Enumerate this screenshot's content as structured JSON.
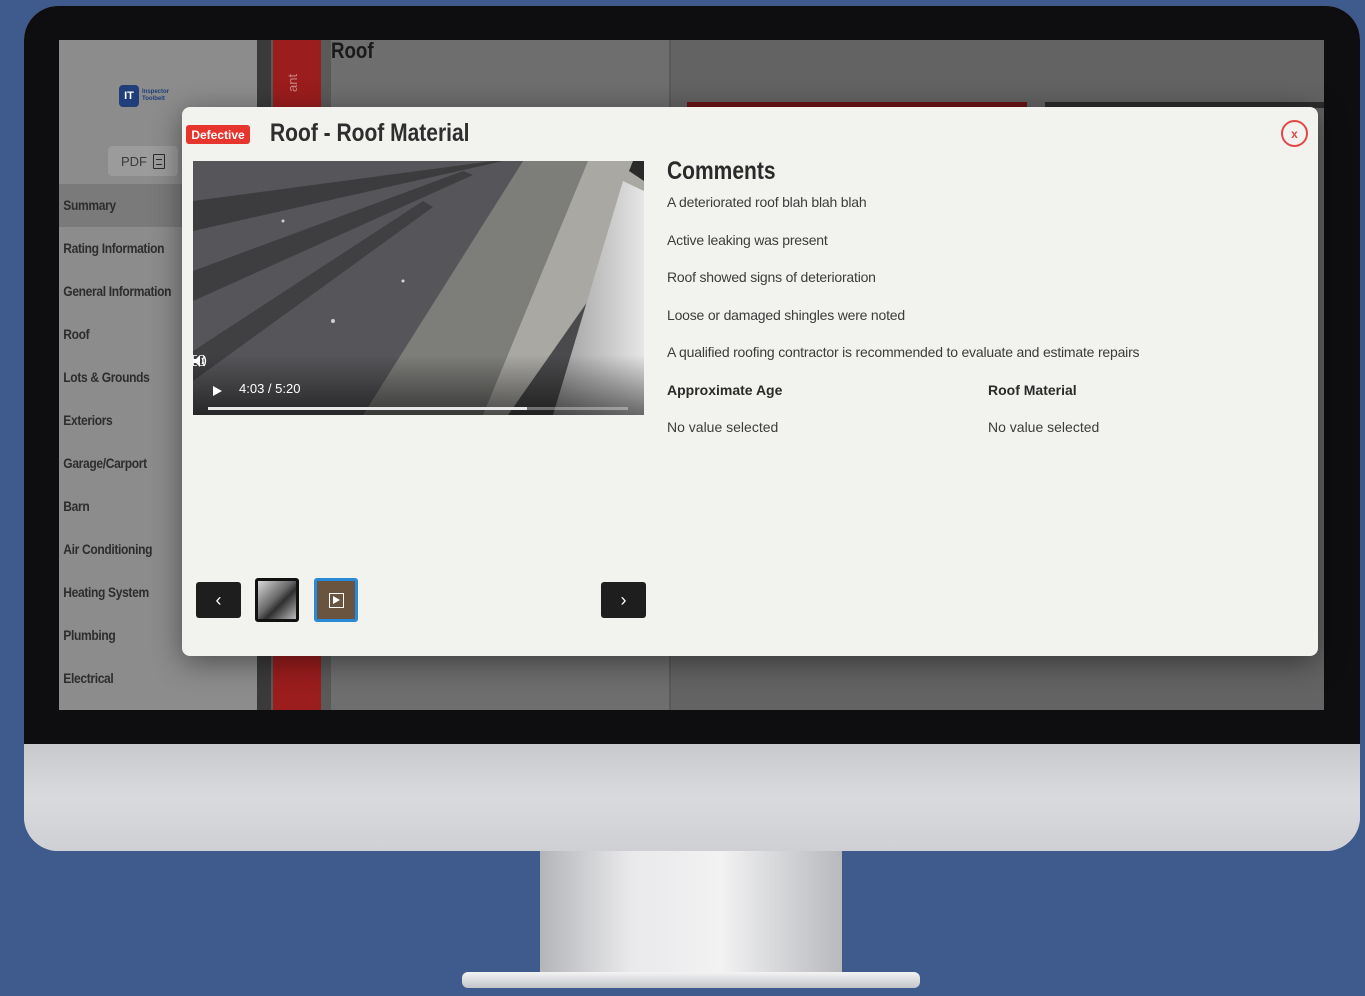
{
  "app": {
    "logo_text_1": "Inspector",
    "logo_text_2": "Toolbelt",
    "logo_mark": "IT",
    "pdf_label": "PDF",
    "pdf_icon": "document-icon",
    "page_title": "Roof",
    "vertical_tab_label": "ant"
  },
  "sidebar": {
    "items": [
      {
        "label": "Summary"
      },
      {
        "label": "Rating Information"
      },
      {
        "label": "General Information"
      },
      {
        "label": "Roof"
      },
      {
        "label": "Lots & Grounds"
      },
      {
        "label": "Exteriors"
      },
      {
        "label": "Garage/Carport"
      },
      {
        "label": "Barn"
      },
      {
        "label": "Air Conditioning"
      },
      {
        "label": "Heating System"
      },
      {
        "label": "Plumbing"
      },
      {
        "label": "Electrical"
      }
    ]
  },
  "modal": {
    "badge": "Defective",
    "title": "Roof - Roof Material",
    "close_label": "x",
    "video": {
      "time": "4:03 / 5:20",
      "progress_fraction": 0.76
    },
    "prev_label": "‹",
    "next_label": "›",
    "comments_heading": "Comments",
    "comments": [
      "A deteriorated roof blah blah blah",
      "Active leaking was present",
      "Roof showed signs of deterioration",
      "Loose or damaged shingles were noted",
      "A qualified roofing contractor is recommended to evaluate and estimate repairs"
    ],
    "fields": [
      {
        "label": "Approximate Age",
        "value": "No value selected"
      },
      {
        "label": "Roof Material",
        "value": "No value selected"
      }
    ]
  },
  "colors": {
    "badge": "#e6352c",
    "close": "#e04848",
    "background": "#3f5a8d",
    "thumb_selected": "#2a8ad8"
  }
}
